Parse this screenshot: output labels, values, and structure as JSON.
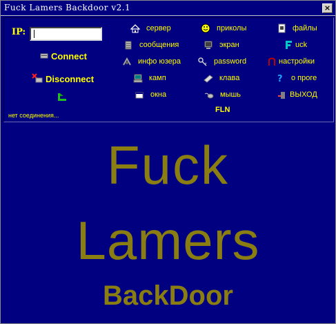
{
  "window": {
    "title": "Fuck Lamers Backdoor v2.1",
    "close_label": "×"
  },
  "connection": {
    "ip_label": "IP:",
    "ip_value": "",
    "connect_label": "Connect",
    "disconnect_label": "Disconnect",
    "status": "нет соединения..."
  },
  "menu": {
    "col1": [
      {
        "label": "сервер",
        "icon": "home-icon"
      },
      {
        "label": "сообщения",
        "icon": "messages-icon"
      },
      {
        "label": "инфо юзера",
        "icon": "user-info-icon"
      },
      {
        "label": "камп",
        "icon": "computer-icon"
      },
      {
        "label": "окна",
        "icon": "window-icon"
      }
    ],
    "col2": [
      {
        "label": "приколы",
        "icon": "smiley-icon"
      },
      {
        "label": "экран",
        "icon": "monitor-icon"
      },
      {
        "label": "password",
        "icon": "keys-icon"
      },
      {
        "label": "клава",
        "icon": "keyboard-icon"
      },
      {
        "label": "мышь",
        "icon": "mouse-icon"
      }
    ],
    "col3": [
      {
        "label": "файлы",
        "icon": "files-icon"
      },
      {
        "label": "uck",
        "icon": "f-letter-icon"
      },
      {
        "label": "настройки",
        "icon": "settings-icon"
      },
      {
        "label": "о проге",
        "icon": "help-icon"
      },
      {
        "label": "ВЫХОД",
        "icon": "exit-icon"
      }
    ],
    "fln": "FLN"
  },
  "banner": {
    "line1": "Fuck",
    "line2": "Lamers",
    "line3": "BackDoor"
  },
  "colors": {
    "background": "#000080",
    "text": "#ffff00",
    "banner_text": "#8a7d12"
  }
}
